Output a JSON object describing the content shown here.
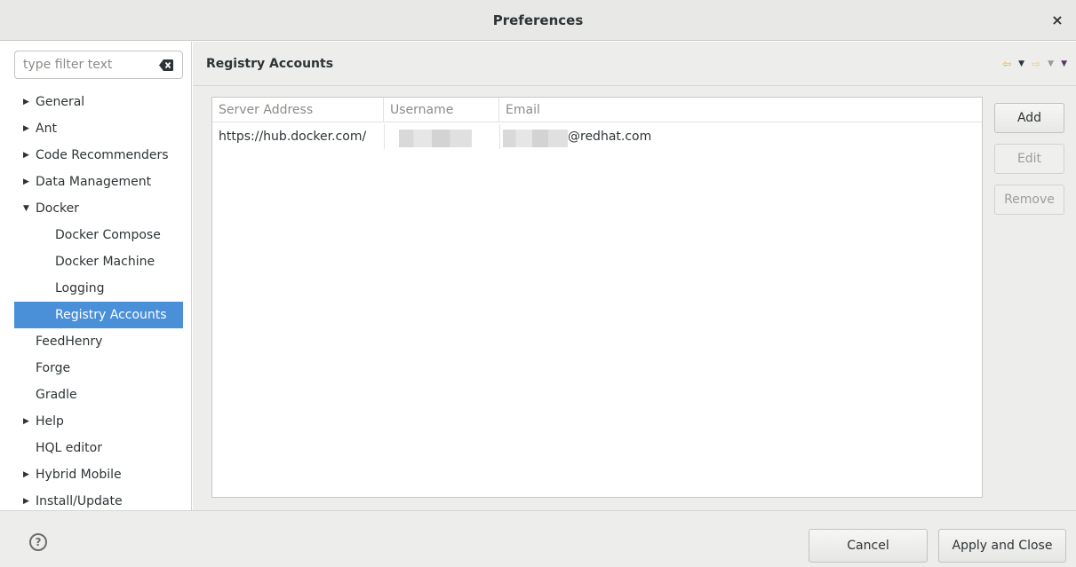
{
  "window": {
    "title": "Preferences",
    "close_glyph": "×"
  },
  "filter": {
    "placeholder": "type filter text",
    "clear_icon": "backspace-icon"
  },
  "tree": [
    {
      "label": "General",
      "expandable": true,
      "expanded": false,
      "level": 0
    },
    {
      "label": "Ant",
      "expandable": true,
      "expanded": false,
      "level": 0
    },
    {
      "label": "Code Recommenders",
      "expandable": true,
      "expanded": false,
      "level": 0
    },
    {
      "label": "Data Management",
      "expandable": true,
      "expanded": false,
      "level": 0
    },
    {
      "label": "Docker",
      "expandable": true,
      "expanded": true,
      "level": 0
    },
    {
      "label": "Docker Compose",
      "expandable": false,
      "level": 1
    },
    {
      "label": "Docker Machine",
      "expandable": false,
      "level": 1
    },
    {
      "label": "Logging",
      "expandable": false,
      "level": 1
    },
    {
      "label": "Registry Accounts",
      "expandable": false,
      "level": 1,
      "selected": true
    },
    {
      "label": "FeedHenry",
      "expandable": false,
      "level": 0
    },
    {
      "label": "Forge",
      "expandable": false,
      "level": 0
    },
    {
      "label": "Gradle",
      "expandable": false,
      "level": 0
    },
    {
      "label": "Help",
      "expandable": true,
      "expanded": false,
      "level": 0
    },
    {
      "label": "HQL editor",
      "expandable": false,
      "level": 0
    },
    {
      "label": "Hybrid Mobile",
      "expandable": true,
      "expanded": false,
      "level": 0
    },
    {
      "label": "Install/Update",
      "expandable": true,
      "expanded": false,
      "level": 0
    }
  ],
  "page": {
    "title": "Registry Accounts",
    "nav_icons": [
      "back-arrow-icon",
      "back-dropdown-icon",
      "forward-arrow-icon",
      "forward-dropdown-icon",
      "view-menu-icon"
    ]
  },
  "table": {
    "columns": [
      "Server Address",
      "Username",
      "Email"
    ],
    "rows": [
      {
        "server": "https://hub.docker.com/",
        "username": "",
        "email_domain": "@redhat.com"
      }
    ]
  },
  "buttons": {
    "add": "Add",
    "edit": "Edit",
    "remove": "Remove"
  },
  "footer": {
    "help_glyph": "?",
    "cancel": "Cancel",
    "apply": "Apply and Close"
  },
  "colors": {
    "selection": "#4a90d9",
    "nav_arrow": "#e8b320"
  }
}
